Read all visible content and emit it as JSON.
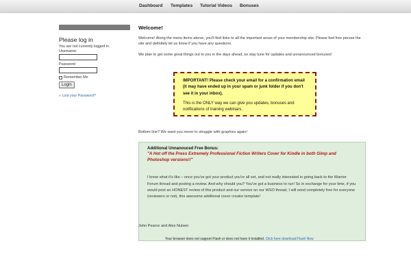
{
  "nav": {
    "items": [
      {
        "label": "Dashboard"
      },
      {
        "label": "Templates"
      },
      {
        "label": "Tutorial Videos"
      },
      {
        "label": "Bonuses"
      }
    ]
  },
  "sidebar": {
    "login_title": "Please log in",
    "status": "You are not currently logged in.",
    "username_label": "Username:",
    "username_value": "",
    "password_label": "Password:",
    "password_value": "",
    "remember_label": "Remember Me",
    "login_button": "Login",
    "lost_arrow": "»",
    "lost_password": "Lost your Password?"
  },
  "main": {
    "title": "Welcome!",
    "welcome": "Welcome! Along the menu items above, you'll find links to all the important areas of your membership site. Please feel free peruse the site and definitely let us know if you have any questions.",
    "plan": "We plan to get some great things out to you in the days ahead, so stay tune for updates and unnanounced bonuses!",
    "notice": {
      "important": "IMPORTANT! Please check your email for a confirmation email (it may have ended up in your spam or junk folder if you don't see it in your inbox).",
      "only_way": "This is the ONLY way we can give you updates, bonuses and notifications of training webinars."
    },
    "bottom_line": "Bottom line?  We want you never to struggle with graphics again!",
    "bonus": {
      "title": "Additional Unnanouced Free Bonus:",
      "offer": "\"A Hot off the Press Extremely Professional Fiction Writers Cover for Kindle in both Gimp and Photoshop versions!!\"",
      "body": "I know what it's like – once you've got your product you're all set, and not really interested in going back to the Warrior Forum thread and posting a review.  And why should you?  You've got a business to run!   So in exchange for your time, if you would post an HONEST review of this product and our service on our WSO thread, I will send completely free for everyone (reviewers or not), this awesome additional cover creator template!"
    },
    "signature": "John Pearce and Alex Nulsen"
  },
  "footer": {
    "flash_text": "Your browser does not support Flash or does not have it installed.",
    "flash_link": "Click here download Flash Now"
  }
}
